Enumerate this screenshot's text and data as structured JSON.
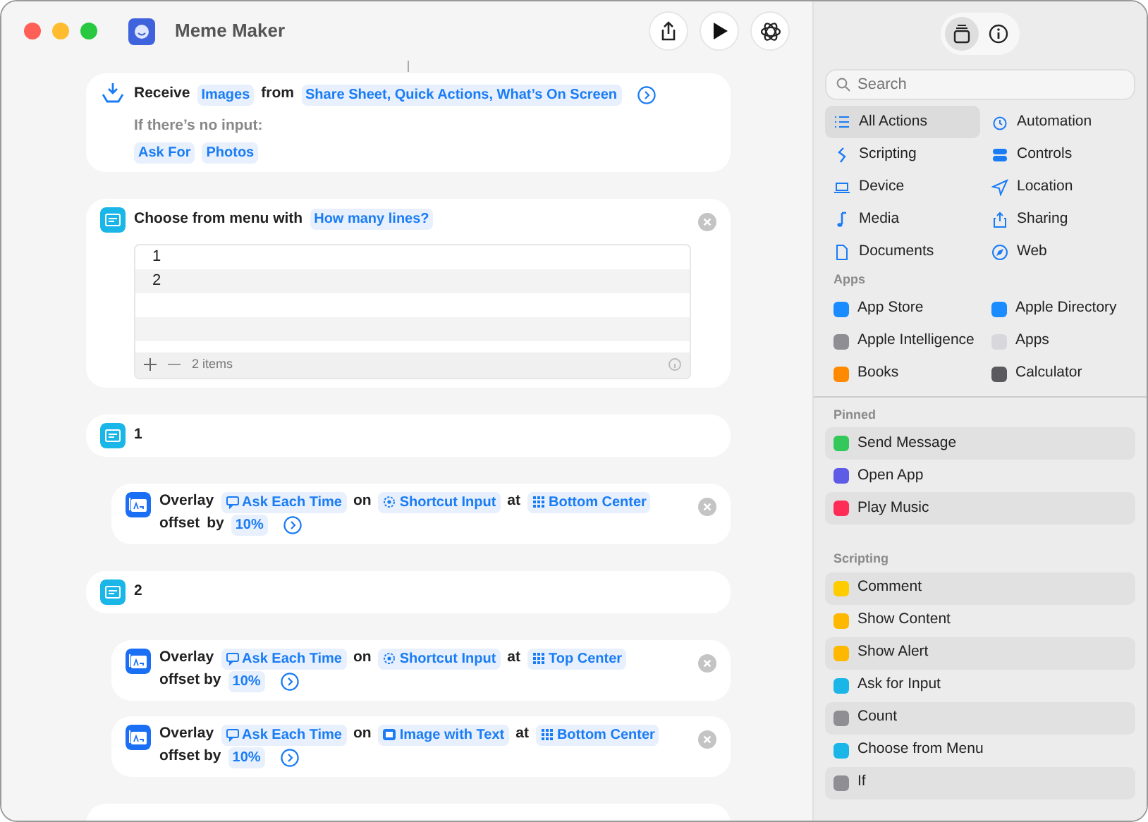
{
  "window": {
    "title": "Meme Maker"
  },
  "sidebar_tabs": [
    {
      "selected": true
    },
    {
      "selected": false
    }
  ],
  "search": {
    "placeholder": "Search"
  },
  "categories": [
    {
      "label": "All Actions",
      "selected": true
    },
    {
      "label": "Automation",
      "selected": false
    },
    {
      "label": "Scripting",
      "selected": false
    },
    {
      "label": "Controls",
      "selected": false
    },
    {
      "label": "Device",
      "selected": false
    },
    {
      "label": "Location",
      "selected": false
    },
    {
      "label": "Media",
      "selected": false
    },
    {
      "label": "Sharing",
      "selected": false
    },
    {
      "label": "Documents",
      "selected": false
    },
    {
      "label": "Web",
      "selected": false
    }
  ],
  "apps": {
    "heading": "Apps",
    "items": [
      {
        "label": "App Store",
        "color": "#1a8cff"
      },
      {
        "label": "Apple Directory",
        "color": "#1a8cff"
      },
      {
        "label": "Apple Intelligence",
        "color": "#8e8e93"
      },
      {
        "label": "Apps",
        "color": "#d8d8dc"
      },
      {
        "label": "Books",
        "color": "#ff8a00"
      },
      {
        "label": "Calculator",
        "color": "#5a5a5e"
      }
    ]
  },
  "pinned": {
    "heading": "Pinned",
    "items": [
      {
        "label": "Send Message",
        "color": "#34c759"
      },
      {
        "label": "Open App",
        "color": "#5e5ce6"
      },
      {
        "label": "Play Music",
        "color": "#ff2d55"
      }
    ]
  },
  "scripting": {
    "heading": "Scripting",
    "items": [
      {
        "label": "Comment",
        "color": "#ffcc00"
      },
      {
        "label": "Show Content",
        "color": "#ffb800"
      },
      {
        "label": "Show Alert",
        "color": "#ffb800"
      },
      {
        "label": "Ask for Input",
        "color": "#1ab6e8"
      },
      {
        "label": "Count",
        "color": "#8e8e93"
      },
      {
        "label": "Choose from Menu",
        "color": "#1ab6e8"
      },
      {
        "label": "If",
        "color": "#8e8e93"
      }
    ]
  },
  "actions": [
    {
      "kind": "receive",
      "parts": [
        {
          "kind": "word",
          "text": "Receive"
        },
        {
          "kind": "chip",
          "text": "Images"
        },
        {
          "kind": "word",
          "text": "from"
        },
        {
          "kind": "chip",
          "text": "Share Sheet, Quick Actions, What’s On Screen"
        },
        {
          "kind": "more"
        }
      ],
      "no_input_label": "If there’s no input:",
      "no_input_chips": [
        "Ask For",
        "Photos"
      ]
    },
    {
      "kind": "menu",
      "parts": [
        {
          "kind": "word",
          "text": "Choose from menu with"
        },
        {
          "kind": "chip",
          "text": "How many lines?"
        }
      ],
      "options": [
        "1",
        "2"
      ],
      "count": "2 items"
    },
    {
      "kind": "case",
      "parts": [
        {
          "kind": "word",
          "text": "1"
        }
      ]
    },
    {
      "kind": "overlay",
      "parts": [
        {
          "kind": "word",
          "text": "Overlay"
        },
        {
          "kind": "prompt-chip",
          "text": "Ask Each Time"
        },
        {
          "kind": "word",
          "text": "on"
        },
        {
          "kind": "input-chip",
          "text": "Shortcut Input"
        },
        {
          "kind": "word",
          "text": "at"
        },
        {
          "kind": "position-chip",
          "text": "Bottom Center"
        },
        {
          "kind": "word",
          "text": "offset"
        },
        {
          "kind": "word",
          "text": "by"
        },
        {
          "kind": "chip",
          "text": "10%"
        },
        {
          "kind": "more"
        }
      ]
    },
    {
      "kind": "case",
      "parts": [
        {
          "kind": "word",
          "text": "2"
        }
      ]
    },
    {
      "kind": "overlay",
      "parts": [
        {
          "kind": "word",
          "text": "Overlay"
        },
        {
          "kind": "prompt-chip",
          "text": "Ask Each Time"
        },
        {
          "kind": "word",
          "text": "on"
        },
        {
          "kind": "input-chip",
          "text": "Shortcut Input"
        },
        {
          "kind": "word",
          "text": "at"
        },
        {
          "kind": "position-chip",
          "text": "Top Center"
        },
        {
          "kind": "word",
          "text": "offset by"
        },
        {
          "kind": "chip",
          "text": "10%"
        },
        {
          "kind": "more"
        }
      ]
    },
    {
      "kind": "overlay",
      "parts": [
        {
          "kind": "word",
          "text": "Overlay"
        },
        {
          "kind": "prompt-chip",
          "text": "Ask Each Time"
        },
        {
          "kind": "word",
          "text": "on"
        },
        {
          "kind": "image-chip",
          "text": "Image with Text"
        },
        {
          "kind": "word",
          "text": "at"
        },
        {
          "kind": "position-chip",
          "text": "Bottom Center"
        },
        {
          "kind": "word",
          "text": "offset by"
        },
        {
          "kind": "chip",
          "text": "10%"
        },
        {
          "kind": "more"
        }
      ]
    },
    {
      "kind": "stub"
    }
  ]
}
